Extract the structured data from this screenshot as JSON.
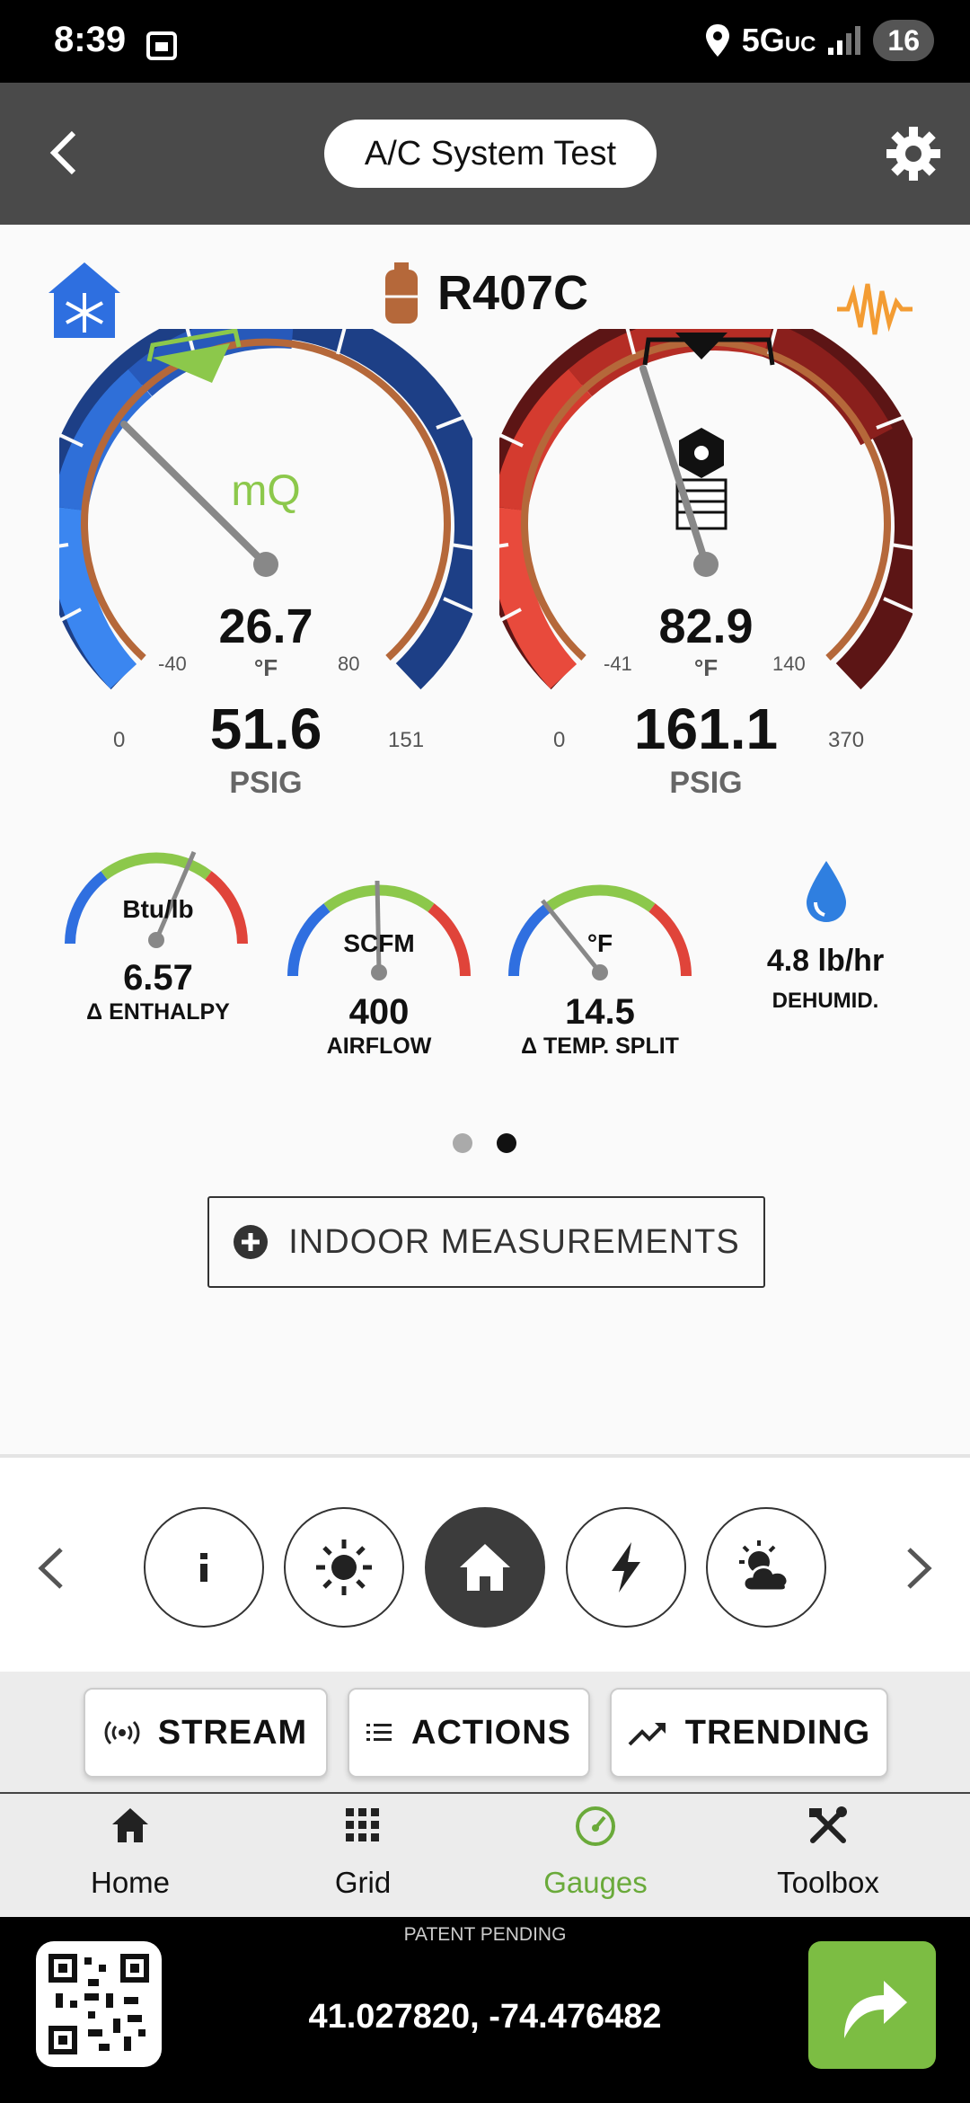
{
  "status_bar": {
    "time": "8:39",
    "network": "5G",
    "network_sub": "UC",
    "battery": "16"
  },
  "header": {
    "title": "A/C System Test"
  },
  "refrigerant": "R407C",
  "suction": {
    "temp": "26.7",
    "temp_unit": "°F",
    "temp_min": "-40",
    "temp_max": "80",
    "pressure": "51.6",
    "pressure_unit": "PSIG",
    "p_min": "0",
    "p_max": "151",
    "brand": "mQ"
  },
  "discharge": {
    "temp": "82.9",
    "temp_unit": "°F",
    "temp_min": "-41",
    "temp_max": "140",
    "pressure": "161.1",
    "pressure_unit": "PSIG",
    "p_min": "0",
    "p_max": "370"
  },
  "mini_gauges": [
    {
      "unit": "Btu/lb",
      "value": "6.57",
      "label": "Δ ENTHALPY"
    },
    {
      "unit": "SCFM",
      "value": "400",
      "label": "AIRFLOW"
    },
    {
      "unit": "°F",
      "value": "14.5",
      "label": "Δ TEMP. SPLIT"
    }
  ],
  "dehumid": {
    "value": "4.8 lb/hr",
    "label": "DEHUMID."
  },
  "indoor_button": "INDOOR MEASUREMENTS",
  "mode_icons": [
    "info-icon",
    "sun-icon",
    "home-icon",
    "lightning-icon",
    "weather-icon"
  ],
  "actions": {
    "stream": "STREAM",
    "actions": "ACTIONS",
    "trending": "TRENDING"
  },
  "nav": [
    {
      "label": "Home",
      "icon": "home-icon"
    },
    {
      "label": "Grid",
      "icon": "grid-icon"
    },
    {
      "label": "Gauges",
      "icon": "gauge-icon",
      "active": true
    },
    {
      "label": "Toolbox",
      "icon": "toolbox-icon"
    }
  ],
  "footer": {
    "patent": "PATENT PENDING",
    "coords": "41.027820, -74.476482"
  },
  "colors": {
    "header": "#4a4a4a",
    "active_nav": "#6aaa3a",
    "share": "#7cbd43"
  }
}
